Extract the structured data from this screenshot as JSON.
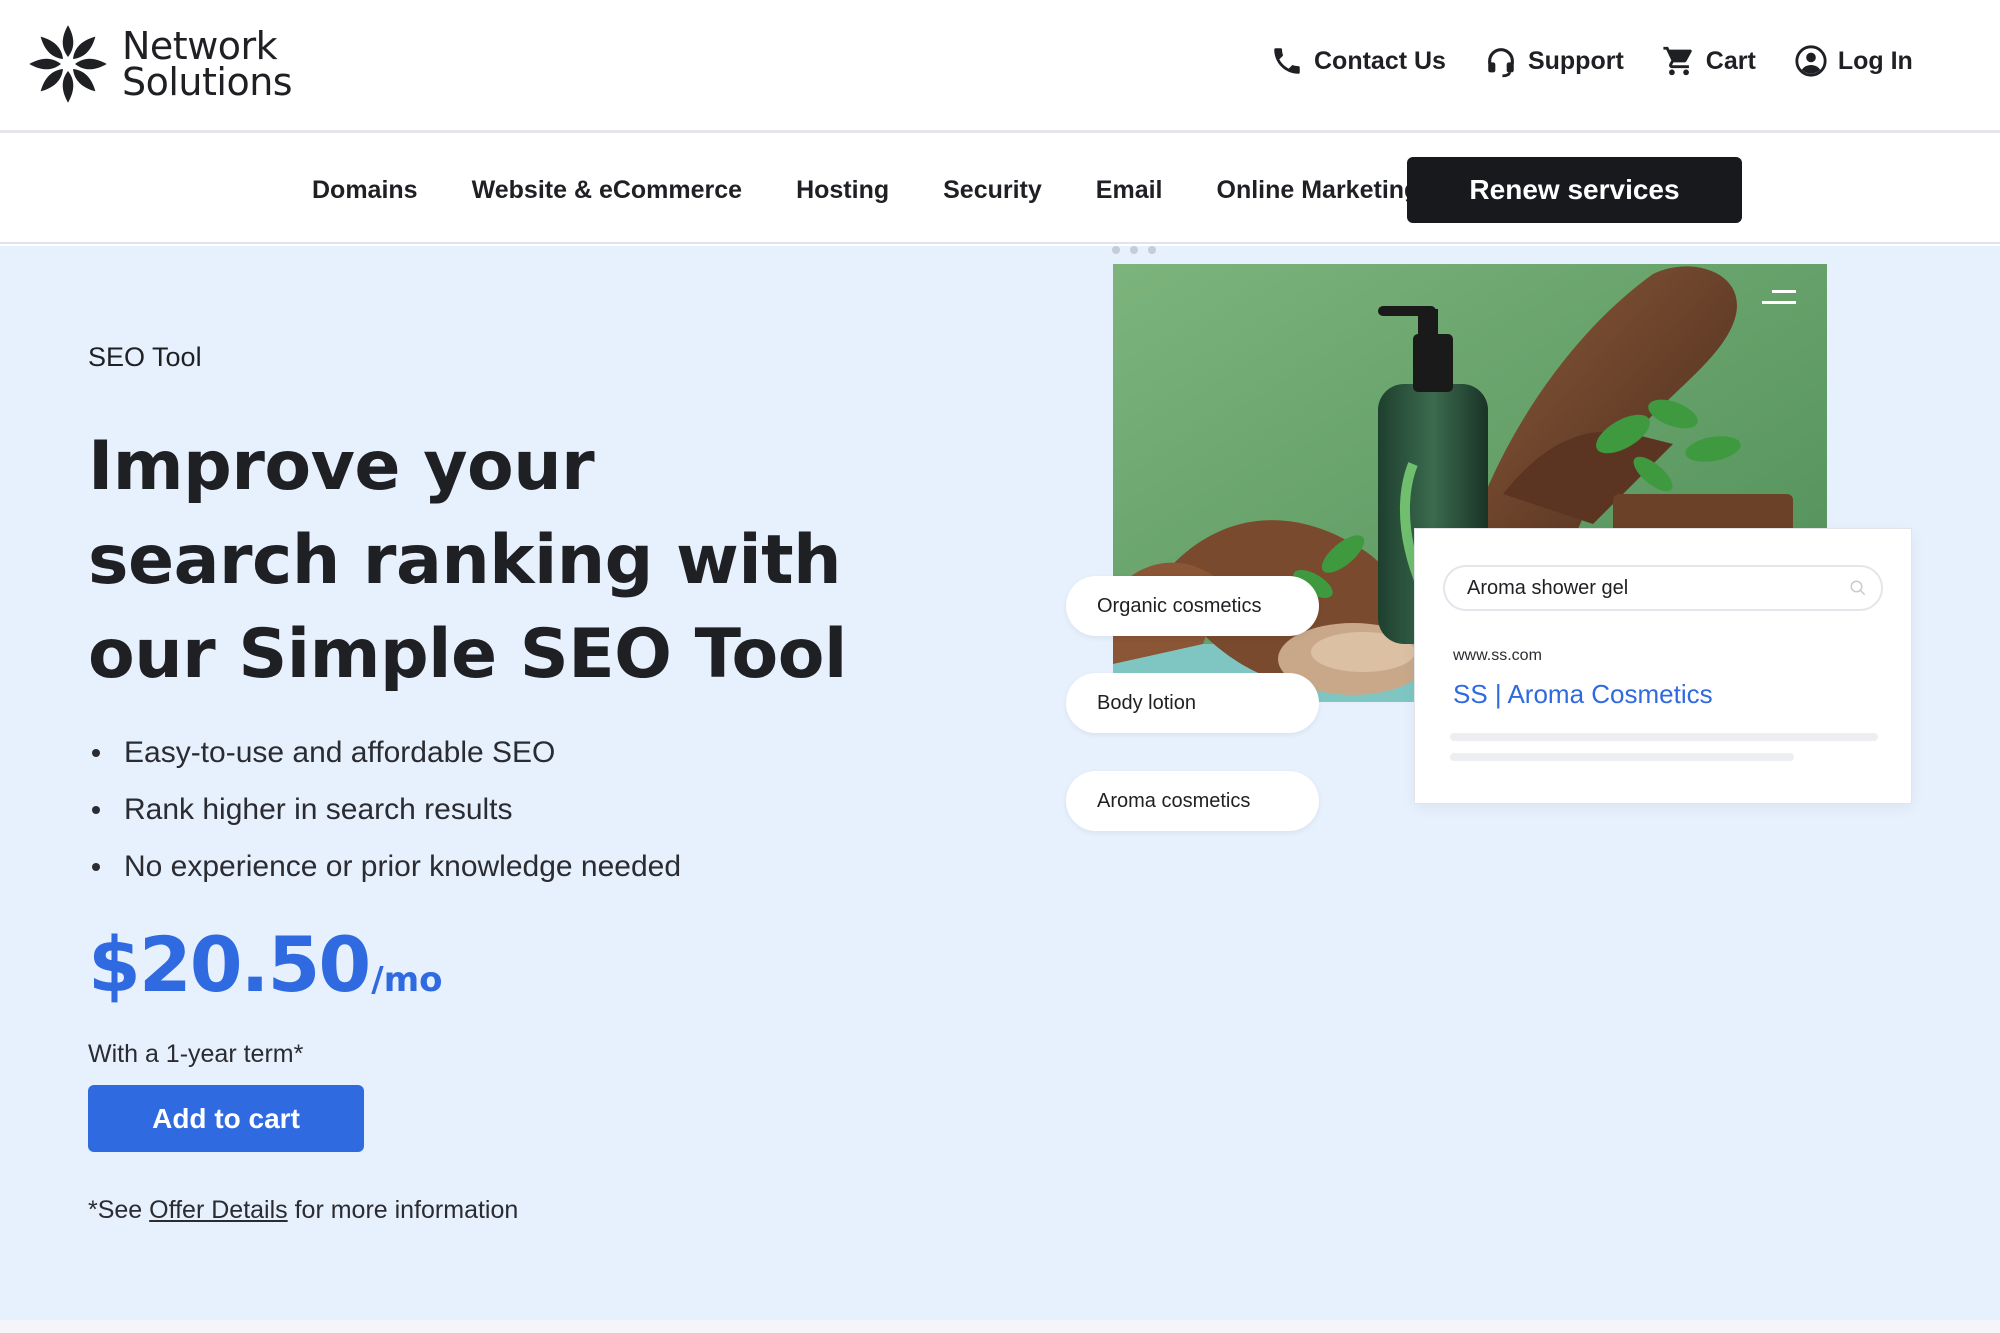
{
  "header": {
    "brand_line1": "Network",
    "brand_line2": "Solutions",
    "utility": [
      {
        "label": "Contact Us",
        "icon": "phone-icon"
      },
      {
        "label": "Support",
        "icon": "headset-icon"
      },
      {
        "label": "Cart",
        "icon": "cart-icon"
      },
      {
        "label": "Log In",
        "icon": "user-circle-icon"
      }
    ]
  },
  "nav": {
    "items": [
      "Domains",
      "Website & eCommerce",
      "Hosting",
      "Security",
      "Email",
      "Online Marketing"
    ],
    "renew_label": "Renew services"
  },
  "hero": {
    "eyebrow": "SEO Tool",
    "headline": "Improve your search ranking with our Simple SEO Tool",
    "bullets": [
      "Easy-to-use and affordable SEO",
      "Rank higher in search results",
      "No experience or prior knowledge needed"
    ],
    "price_amount": "$20.50",
    "price_period": "/mo",
    "term": "With a 1-year term*",
    "cta_label": "Add to cart",
    "offer_prefix": "*See ",
    "offer_link": "Offer Details",
    "offer_suffix": " for more information"
  },
  "illustration": {
    "chips": [
      "Organic cosmetics",
      "Body lotion",
      "Aroma cosmetics"
    ],
    "search_query": "Aroma shower gel",
    "result_url": "www.ss.com",
    "result_title": "SS | Aroma Cosmetics"
  },
  "colors": {
    "accent": "#2f6ae0",
    "hero_bg": "#e7f0fd",
    "dark_button": "#17191d"
  }
}
